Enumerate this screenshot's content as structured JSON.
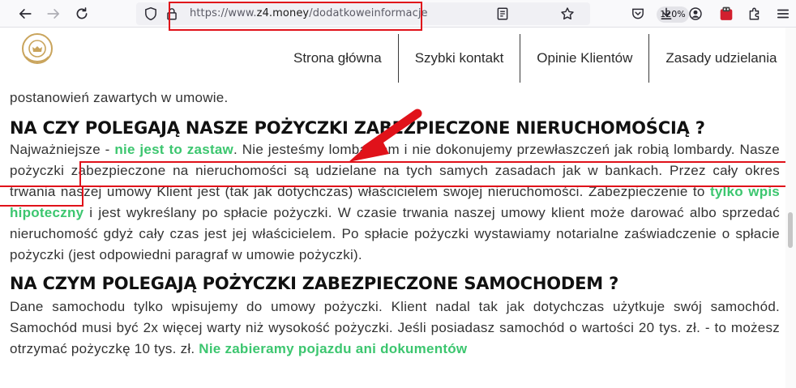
{
  "browser": {
    "url_prefix": "https://www.",
    "url_host": "z4.money",
    "url_path": "/dodatkoweinformacje",
    "zoom": "120%"
  },
  "nav": {
    "items": [
      "Strona główna",
      "Szybki kontakt",
      "Opinie Klientów",
      "Zasady udzielania"
    ]
  },
  "content": {
    "line0": "postanowień zawartych w umowie.",
    "heading1": "NA CZY POLEGAJĄ NASZE POŻYCZKI ZABEZPIECZONE NIERUCHOMOŚCIĄ ?",
    "p1_a": "Najważniejsze - ",
    "p1_green1": "nie jest to zastaw",
    "p1_b": ". Nie jesteśmy lombardem i nie dokonujemy przewłaszczeń jak robią lombardy.",
    "p1_highlight": " Nasze pożyczki zabezpieczone na nieruchomości są udzielane na tych samych zasadach jak w bankach.",
    "p1_c": " Przez cały okres trwania naszej umowy Klient jest (tak jak dotychczas) właścicielem swojej nieruchomości. Zabezpieczenie to ",
    "p1_green2": "tylko wpis hipoteczny",
    "p1_d": " i jest wykreślany po spłacie pożyczki.  W czasie trwania naszej umowy klient może darować albo sprzedać nieruchomość gdyż cały czas jest jej właścicielem. Po spłacie pożyczki wystawiamy notarialne zaświadczenie o spłacie pożyczki (jest odpowiedni paragraf w umowie pożyczki).",
    "heading2": "NA CZYM POLEGAJĄ POŻYCZKI ZABEZPIECZONE SAMOCHODEM ?",
    "p2_a": "Dane samochodu tylko wpisujemy do umowy pożyczki. Klient nadal tak jak dotychczas użytkuje swój samochód. Samochód musi być 2x więcej warty niż wysokość pożyczki. Jeśli posiadasz samochód o wartości 20 tys. zł. - to możesz otrzymać pożyczkę 10 tys. zł. ",
    "p2_green": "Nie zabieramy pojazdu ani dokumentów"
  },
  "colors": {
    "accent_green": "#3cc66f",
    "annotation_red": "#e0121a"
  },
  "icons": [
    "back-arrow-icon",
    "forward-arrow-icon",
    "reload-icon",
    "shield-icon",
    "lock-icon",
    "reader-view-icon",
    "bookmark-star-icon",
    "pocket-icon",
    "download-icon",
    "account-icon",
    "extension-badge-icon",
    "extensions-icon",
    "menu-icon",
    "lion-logo-icon"
  ]
}
